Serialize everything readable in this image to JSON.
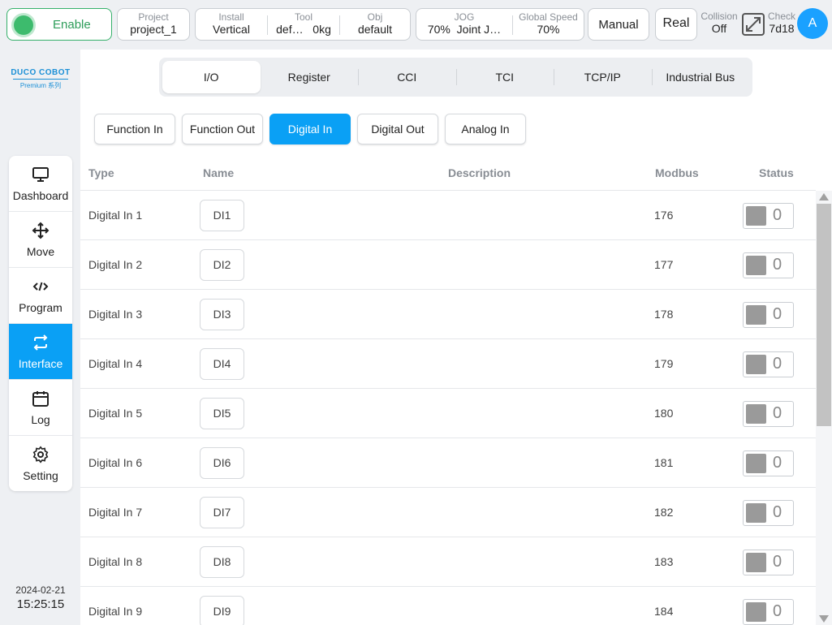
{
  "topbar": {
    "enable_label": "Enable",
    "project": {
      "label": "Project",
      "value": "project_1"
    },
    "install": {
      "label": "Install",
      "value": "Vertical"
    },
    "tool": {
      "label": "Tool",
      "value": "def…",
      "extra": "0kg"
    },
    "obj": {
      "label": "Obj",
      "value": "default"
    },
    "jog": {
      "label": "JOG",
      "value": "70%",
      "mode": "Joint J…"
    },
    "global_speed": {
      "label": "Global Speed",
      "value": "70%"
    },
    "manual_label": "Manual",
    "real_label": "Real",
    "collision": {
      "label": "Collision",
      "value": "Off"
    },
    "check": {
      "label": "Check",
      "value": "7d18"
    },
    "avatar_letter": "A"
  },
  "logo": {
    "brand": "DUCO COBOT",
    "sub": "Premium 系列"
  },
  "sidebar": {
    "items": [
      {
        "label": "Dashboard",
        "icon": "monitor-icon"
      },
      {
        "label": "Move",
        "icon": "move-arrows-icon"
      },
      {
        "label": "Program",
        "icon": "code-icon"
      },
      {
        "label": "Interface",
        "icon": "swap-icon"
      },
      {
        "label": "Log",
        "icon": "calendar-icon"
      },
      {
        "label": "Setting",
        "icon": "gear-icon"
      }
    ],
    "active": "Interface"
  },
  "datetime": {
    "date": "2024-02-21",
    "time": "15:25:15"
  },
  "topnav": {
    "tabs": [
      "I/O",
      "Register",
      "CCI",
      "TCI",
      "TCP/IP",
      "Industrial Bus"
    ],
    "active": "I/O"
  },
  "subtabs": {
    "tabs": [
      "Function In",
      "Function Out",
      "Digital In",
      "Digital Out",
      "Analog In"
    ],
    "active": "Digital In"
  },
  "table": {
    "headers": {
      "type": "Type",
      "name": "Name",
      "description": "Description",
      "modbus": "Modbus",
      "status": "Status"
    },
    "rows": [
      {
        "type": "Digital In 1",
        "name": "DI1",
        "description": "",
        "modbus": "176",
        "status": "0"
      },
      {
        "type": "Digital In 2",
        "name": "DI2",
        "description": "",
        "modbus": "177",
        "status": "0"
      },
      {
        "type": "Digital In 3",
        "name": "DI3",
        "description": "",
        "modbus": "178",
        "status": "0"
      },
      {
        "type": "Digital In 4",
        "name": "DI4",
        "description": "",
        "modbus": "179",
        "status": "0"
      },
      {
        "type": "Digital In 5",
        "name": "DI5",
        "description": "",
        "modbus": "180",
        "status": "0"
      },
      {
        "type": "Digital In 6",
        "name": "DI6",
        "description": "",
        "modbus": "181",
        "status": "0"
      },
      {
        "type": "Digital In 7",
        "name": "DI7",
        "description": "",
        "modbus": "182",
        "status": "0"
      },
      {
        "type": "Digital In 8",
        "name": "DI8",
        "description": "",
        "modbus": "183",
        "status": "0"
      },
      {
        "type": "Digital In 9",
        "name": "DI9",
        "description": "",
        "modbus": "184",
        "status": "0"
      }
    ]
  },
  "colors": {
    "accent": "#0aa0f5",
    "enable_green": "#3dbb6d",
    "status_off": "#9a9a9a"
  }
}
